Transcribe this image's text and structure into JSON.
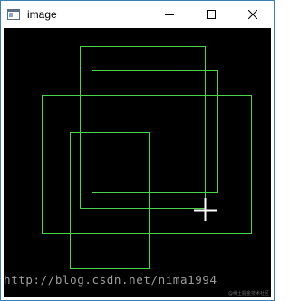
{
  "window": {
    "title": "image",
    "icons": {
      "app": "opencv-window-icon",
      "minimize": "minimize-icon",
      "maximize": "maximize-icon",
      "close": "close-icon"
    }
  },
  "canvas": {
    "background": "#000000",
    "rectangle_color": "#4cd44c",
    "cursor_color": "#ffffff",
    "cursor": "crosshair-cursor-icon",
    "rectangle_count": 4
  },
  "watermark": {
    "text": "http://blog.csdn.net/nima1994",
    "corner_text": "@稀土掘金技术社区"
  }
}
